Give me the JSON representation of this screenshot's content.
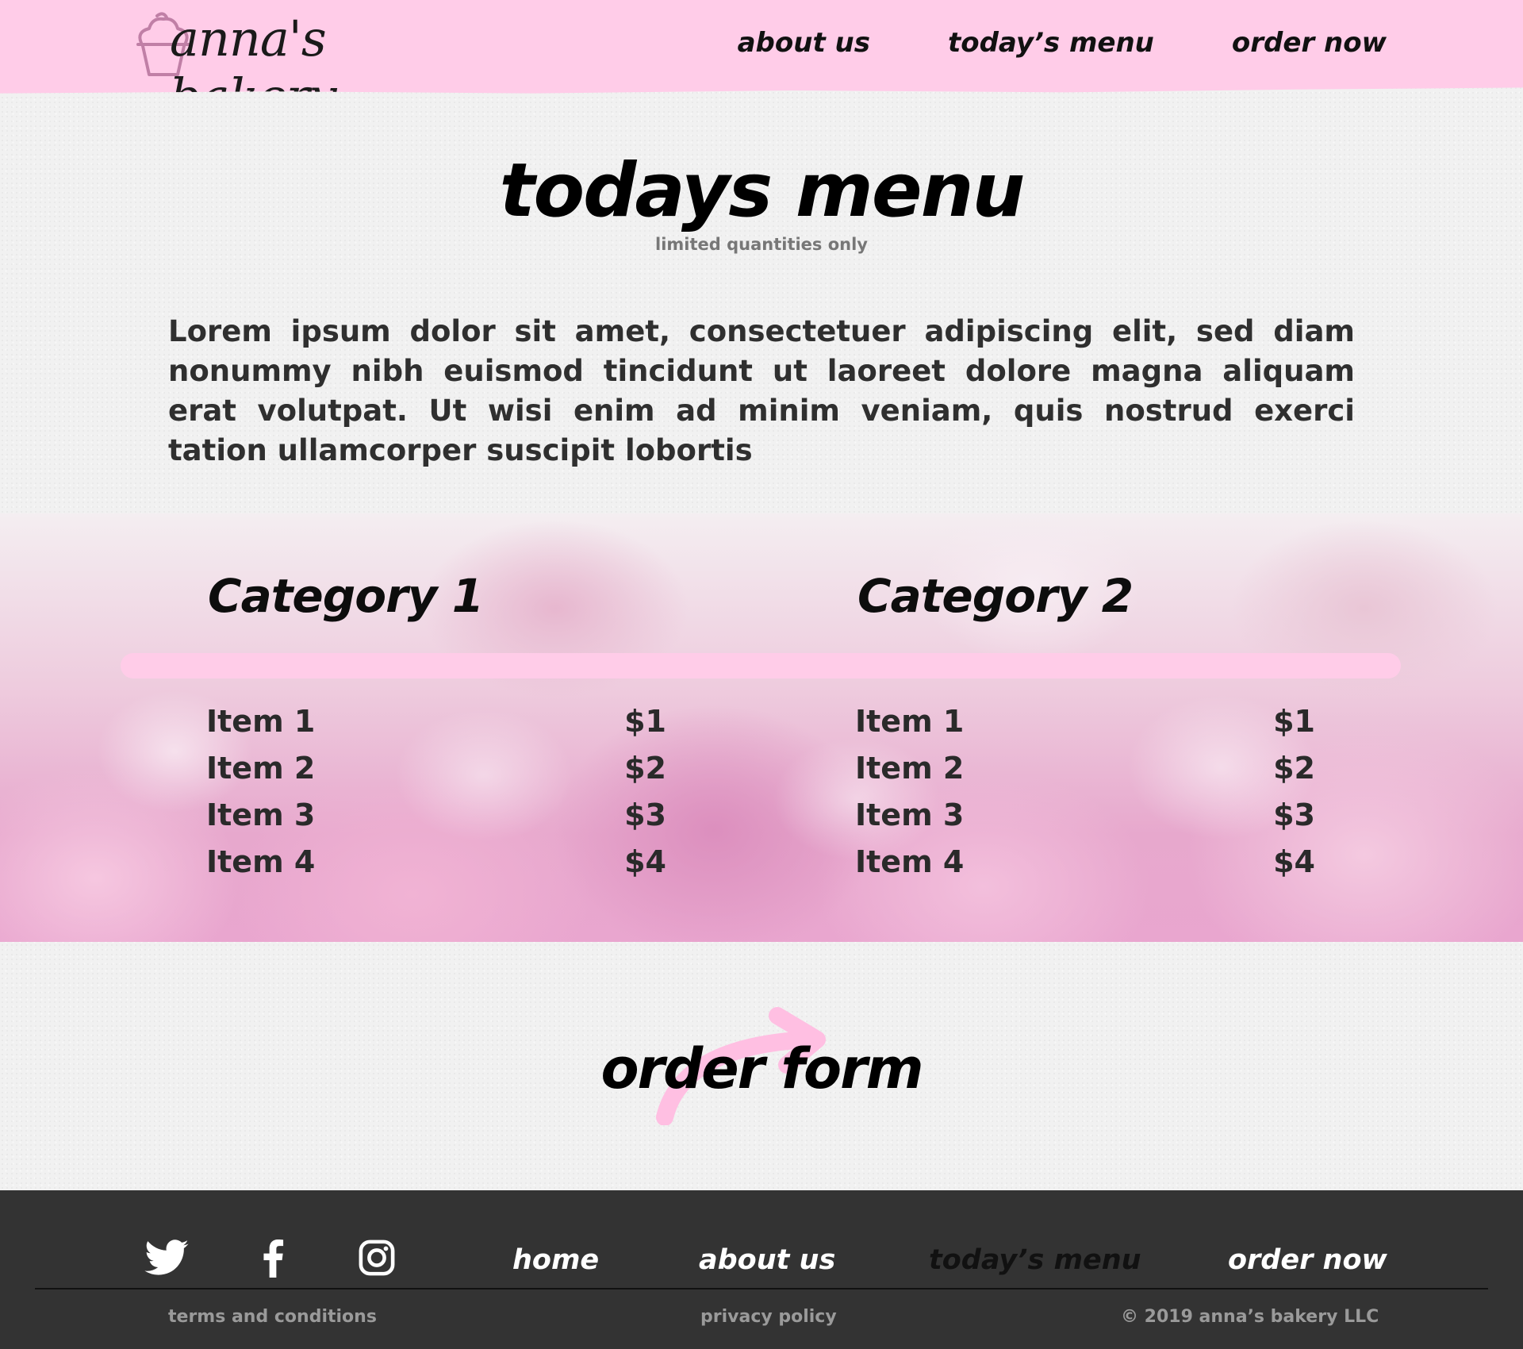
{
  "header": {
    "logo_text": "anna's bakery",
    "nav": [
      {
        "label": "about us"
      },
      {
        "label": "today’s menu"
      },
      {
        "label": "order now"
      }
    ]
  },
  "hero": {
    "title": "todays menu",
    "subtitle": "limited quantities only",
    "body": "Lorem ipsum dolor sit amet, consectetuer adipiscing elit, sed diam nonummy nibh euismod tincidunt ut laoreet dolore magna aliquam erat volutpat. Ut wisi enim ad minim veniam, quis nostrud exerci tation ullamcorper suscipit lobortis"
  },
  "menu": {
    "categories": [
      {
        "title": "Category 1",
        "items": [
          {
            "name": "Item 1",
            "price": "$1"
          },
          {
            "name": "Item 2",
            "price": "$2"
          },
          {
            "name": "Item 3",
            "price": "$3"
          },
          {
            "name": "Item 4",
            "price": "$4"
          }
        ]
      },
      {
        "title": "Category 2",
        "items": [
          {
            "name": "Item 1",
            "price": "$1"
          },
          {
            "name": "Item 2",
            "price": "$2"
          },
          {
            "name": "Item 3",
            "price": "$3"
          },
          {
            "name": "Item 4",
            "price": "$4"
          }
        ]
      }
    ]
  },
  "order": {
    "label": "order form"
  },
  "footer": {
    "social_icons": [
      "twitter-icon",
      "facebook-icon",
      "instagram-icon"
    ],
    "nav": [
      {
        "label": "home"
      },
      {
        "label": "about us"
      },
      {
        "label": "today’s menu"
      },
      {
        "label": "order now"
      }
    ],
    "terms": "terms and conditions",
    "privacy": "privacy policy",
    "copyright": "© 2019 anna’s bakery LLC"
  },
  "colors": {
    "header_pink": "#ffcce8",
    "footer_bg": "#333333",
    "cupcake_stroke": "#c07fa6"
  }
}
